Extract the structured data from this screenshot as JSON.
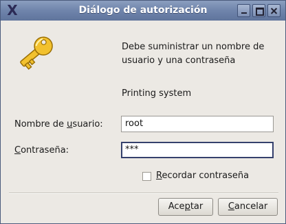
{
  "window": {
    "title": "Diálogo de autorización"
  },
  "icons": {
    "app": "x-logo-icon",
    "dialog": "key-icon",
    "colors": {
      "key_fill": "#f2c12e",
      "key_stroke": "#9a6f05"
    }
  },
  "dialog": {
    "message": "Debe suministrar un nombre de usuario y una contraseña",
    "system": "Printing system"
  },
  "form": {
    "username": {
      "label_pre": "Nombre de ",
      "label_u": "u",
      "label_post": "suario:",
      "value": "root"
    },
    "password": {
      "label_pre": "",
      "label_u": "C",
      "label_post": "ontraseña:",
      "value": "***"
    },
    "remember": {
      "label_u": "R",
      "label_post": "ecordar contraseña",
      "checked": false
    }
  },
  "buttons": {
    "ok": {
      "pre": "Ace",
      "u": "p",
      "post": "tar"
    },
    "cancel": {
      "pre": "",
      "u": "C",
      "post": "ancelar"
    }
  }
}
